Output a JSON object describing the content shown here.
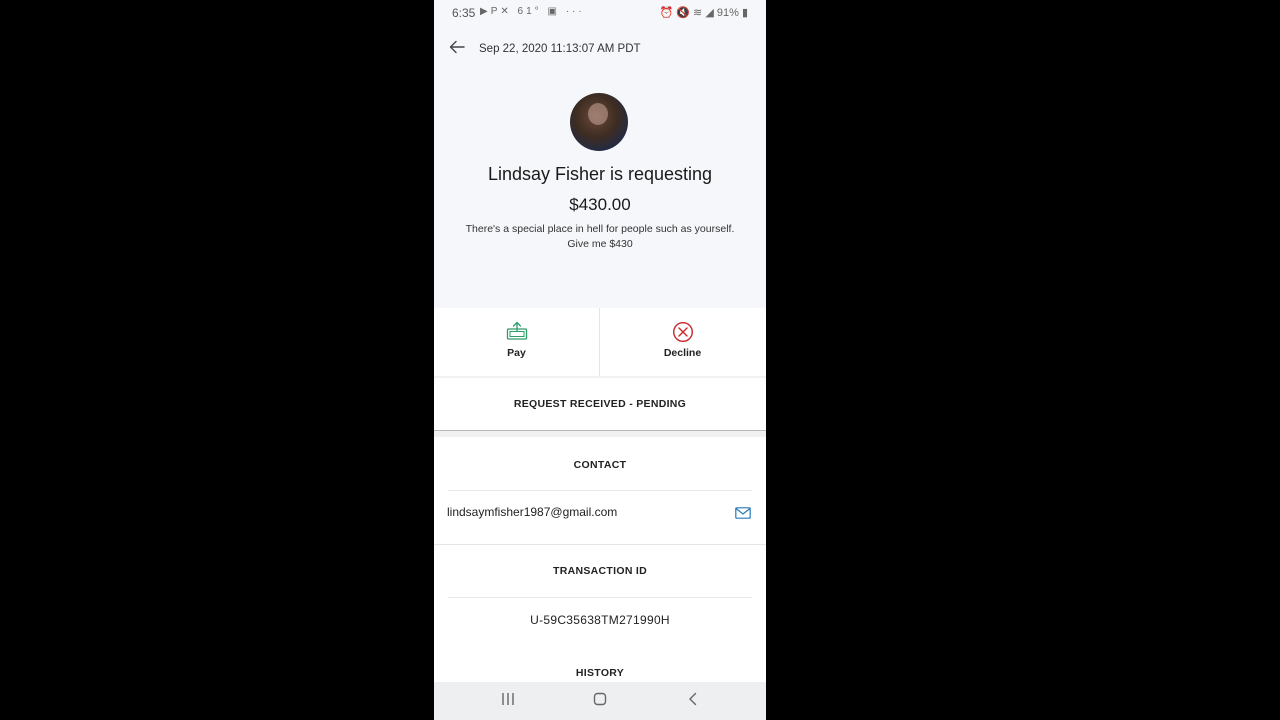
{
  "status_bar": {
    "time": "6:35",
    "temperature": "61°",
    "more": "···",
    "battery": "91%",
    "icons": [
      "youtube-icon",
      "paypal-icon",
      "app-icon",
      "gallery-icon",
      "alarm-icon",
      "mute-icon",
      "wifi-icon",
      "signal-icon",
      "battery-icon"
    ]
  },
  "header": {
    "datetime": "Sep 22, 2020 11:13:07 AM PDT"
  },
  "request": {
    "title": "Lindsay Fisher is requesting",
    "amount": "$430.00",
    "note_line1": "There's a special place in hell for people such as yourself.",
    "note_line2": "Give me $430"
  },
  "actions": {
    "pay_label": "Pay",
    "decline_label": "Decline"
  },
  "status": {
    "label": "REQUEST RECEIVED - PENDING"
  },
  "contact": {
    "heading": "CONTACT",
    "email": "lindsaymfisher1987@gmail.com"
  },
  "transaction": {
    "heading": "TRANSACTION ID",
    "id": "U-59C35638TM271990H"
  },
  "history": {
    "heading": "HISTORY"
  },
  "colors": {
    "pay_accent": "#2e9e6a",
    "decline_accent": "#c8282d",
    "mail_accent": "#2a7ab8",
    "header_bg": "#f5f7fa"
  }
}
